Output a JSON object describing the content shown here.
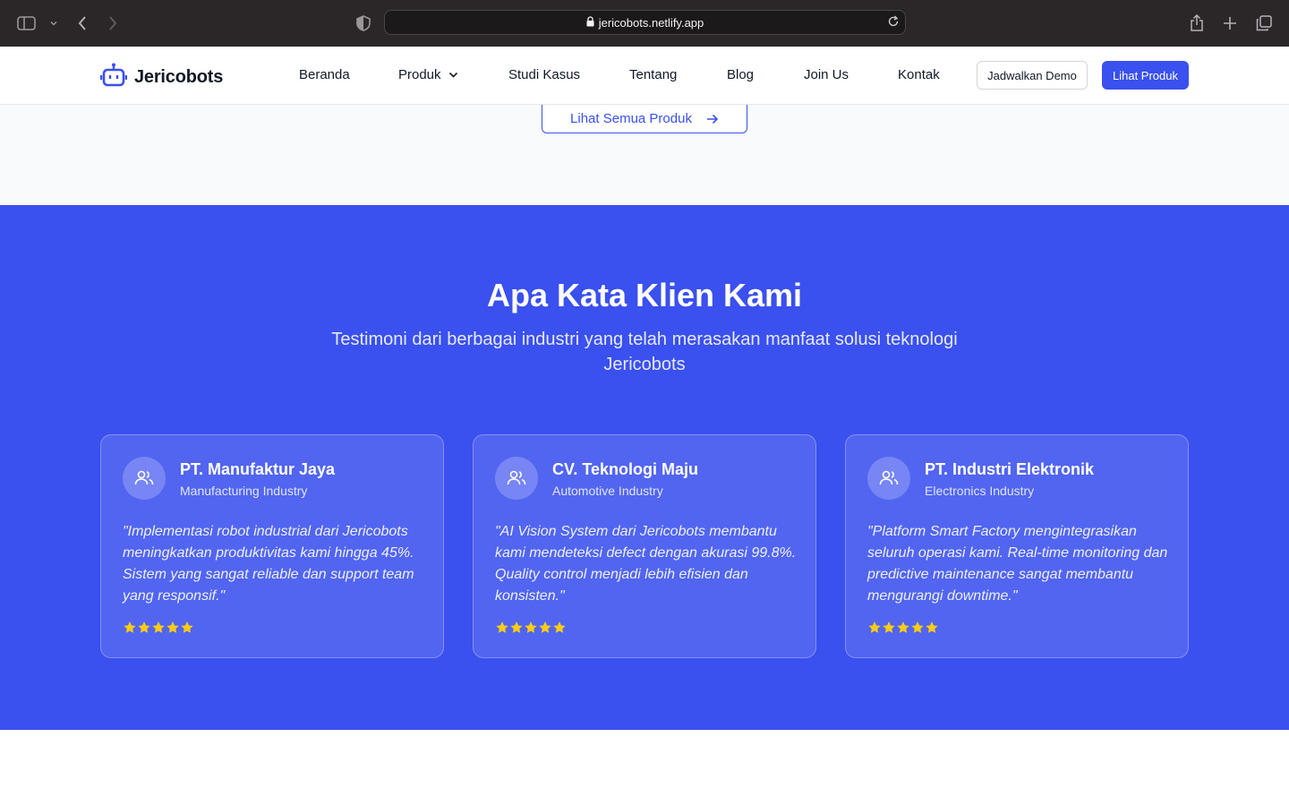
{
  "browser": {
    "url": "jericobots.netlify.app"
  },
  "header": {
    "logo_text": "Jericobots",
    "nav": [
      {
        "label": "Beranda"
      },
      {
        "label": "Produk"
      },
      {
        "label": "Studi Kasus"
      },
      {
        "label": "Tentang"
      },
      {
        "label": "Blog"
      },
      {
        "label": "Join Us"
      },
      {
        "label": "Kontak"
      }
    ],
    "demo_button": "Jadwalkan Demo",
    "products_button": "Lihat Produk"
  },
  "products_section": {
    "see_all_button": "Lihat Semua Produk"
  },
  "testimonials": {
    "title": "Apa Kata Klien Kami",
    "subtitle": "Testimoni dari berbagai industri yang telah merasakan manfaat solusi teknologi Jericobots",
    "cards": [
      {
        "company": "PT. Manufaktur Jaya",
        "industry": "Manufacturing Industry",
        "quote": "\"Implementasi robot industrial dari Jericobots meningkatkan produktivitas kami hingga 45%. Sistem yang sangat reliable dan support team yang responsif.\"",
        "rating": 5
      },
      {
        "company": "CV. Teknologi Maju",
        "industry": "Automotive Industry",
        "quote": "\"AI Vision System dari Jericobots membantu kami mendeteksi defect dengan akurasi 99.8%. Quality control menjadi lebih efisien dan konsisten.\"",
        "rating": 5
      },
      {
        "company": "PT. Industri Elektronik",
        "industry": "Electronics Industry",
        "quote": "\"Platform Smart Factory mengintegrasikan seluruh operasi kami. Real-time monitoring dan predictive maintenance sangat membantu mengurangi downtime.\"",
        "rating": 5
      }
    ]
  },
  "colors": {
    "brand": "#3a50ef",
    "star": "#facc15"
  }
}
